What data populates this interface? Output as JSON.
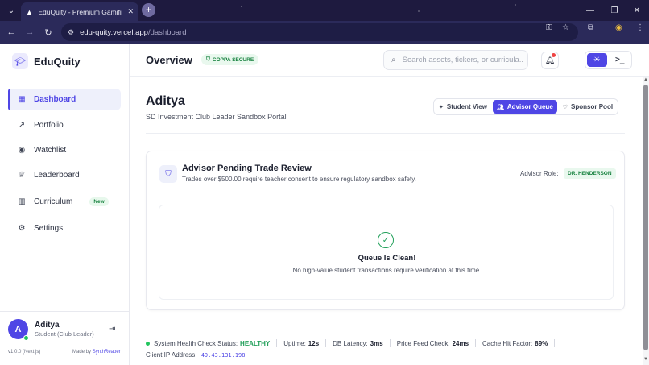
{
  "browser": {
    "tab_title": "EduQuity - Premium Gamified I",
    "url_host": "edu-quity.vercel.app",
    "url_path": "/dashboard"
  },
  "sidebar": {
    "brand": "EduQuity",
    "items": [
      {
        "label": "Dashboard",
        "icon": "dashboard-grid-icon"
      },
      {
        "label": "Portfolio",
        "icon": "trending-up-icon"
      },
      {
        "label": "Watchlist",
        "icon": "eye-icon"
      },
      {
        "label": "Leaderboard",
        "icon": "trophy-icon"
      },
      {
        "label": "Curriculum",
        "icon": "book-icon",
        "badge": "New"
      },
      {
        "label": "Settings",
        "icon": "gear-icon"
      }
    ],
    "user": {
      "initial": "A",
      "name": "Aditya",
      "role": "Student (Club Leader)"
    },
    "version": "v1.0.0 (Next.js)",
    "made_by_prefix": "Made by",
    "made_by_name": "SynthReaper"
  },
  "topbar": {
    "title": "Overview",
    "coppa_badge": "COPPA SECURE",
    "search_placeholder": "Search assets, tickers, or curricula..."
  },
  "main": {
    "user_name": "Aditya",
    "portal_subtitle": "SD Investment Club Leader Sandbox Portal",
    "view_tabs": [
      {
        "label": "Student View",
        "active": false
      },
      {
        "label": "Advisor Queue",
        "active": true
      },
      {
        "label": "Sponsor Pool",
        "active": false
      }
    ],
    "card": {
      "title": "Advisor Pending Trade Review",
      "subtitle": "Trades over $500.00 require teacher consent to ensure regulatory sandbox safety.",
      "advisor_role_label": "Advisor Role:",
      "advisor_role_value": "DR. HENDERSON",
      "empty_title": "Queue Is Clean!",
      "empty_subtitle": "No high-value student transactions require verification at this time."
    },
    "status": {
      "health_label": "System Health Check Status:",
      "health_value": "HEALTHY",
      "uptime_label": "Uptime:",
      "uptime_value": "12s",
      "latency_label": "DB Latency:",
      "latency_value": "3ms",
      "price_label": "Price Feed Check:",
      "price_value": "24ms",
      "cache_label": "Cache Hit Factor:",
      "cache_value": "89%",
      "ip_label": "Client IP Address:",
      "ip_value": "49.43.131.198"
    }
  },
  "colors": {
    "accent": "#4f46e5",
    "success": "#22a05a",
    "browser_frame": "#2b2a5a"
  }
}
